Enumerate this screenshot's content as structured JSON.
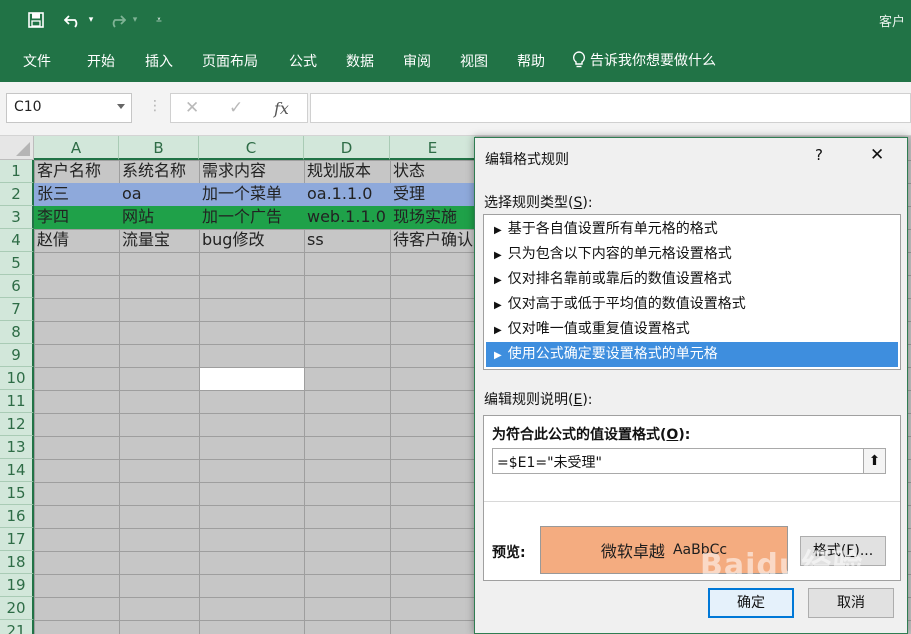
{
  "titlebar": {
    "title": "客户"
  },
  "ribbon": {
    "tabs": [
      "文件",
      "开始",
      "插入",
      "页面布局",
      "公式",
      "数据",
      "审阅",
      "视图",
      "帮助"
    ],
    "tell_me": "告诉我你想要做什么"
  },
  "formula_bar": {
    "name_box": "C10",
    "fx": "fx",
    "value": ""
  },
  "sheet": {
    "columns": [
      "A",
      "B",
      "C",
      "D",
      "E"
    ],
    "rows": [
      "1",
      "2",
      "3",
      "4",
      "5",
      "6",
      "7",
      "8",
      "9",
      "10",
      "11",
      "12",
      "13",
      "14",
      "15",
      "16",
      "17",
      "18",
      "19",
      "20",
      "21"
    ],
    "data": [
      [
        "客户名称",
        "系统名称",
        "需求内容",
        "规划版本",
        "状态"
      ],
      [
        "张三",
        "oa",
        "加一个菜单",
        "oa.1.1.0",
        "受理"
      ],
      [
        "李四",
        "网站",
        "加一个广告",
        "web.1.1.0",
        "现场实施"
      ],
      [
        "赵倩",
        "流量宝",
        "bug修改",
        "ss",
        "待客户确认"
      ]
    ],
    "row_colors": {
      "row2": "#8ea9db",
      "row3": "#1fa149",
      "grid": "#c6c6c6",
      "header_green": "#217346"
    }
  },
  "dialog": {
    "title": "编辑格式规则",
    "help": "?",
    "select_type_label": "选择规则类型(",
    "select_type_key": "S",
    "rules": [
      "基于各自值设置所有单元格的格式",
      "只为包含以下内容的单元格设置格式",
      "仅对排名靠前或靠后的数值设置格式",
      "仅对高于或低于平均值的数值设置格式",
      "仅对唯一值或重复值设置格式",
      "使用公式确定要设置格式的单元格"
    ],
    "selected_rule": 5,
    "edit_desc_label": "编辑规则说明(",
    "edit_desc_key": "E",
    "formula_label": "为符合此公式的值设置格式(",
    "formula_key": "O",
    "formula_value": "=$E1=\"未受理\"",
    "preview_label": "预览:",
    "preview_text": "微软卓越",
    "preview_sample": "AaBbCc",
    "preview_color": "#f4ac80",
    "format_button": "格式(",
    "format_key": "F",
    "ok_button": "确定",
    "cancel_button": "取消"
  },
  "watermark": "Baidu经验"
}
